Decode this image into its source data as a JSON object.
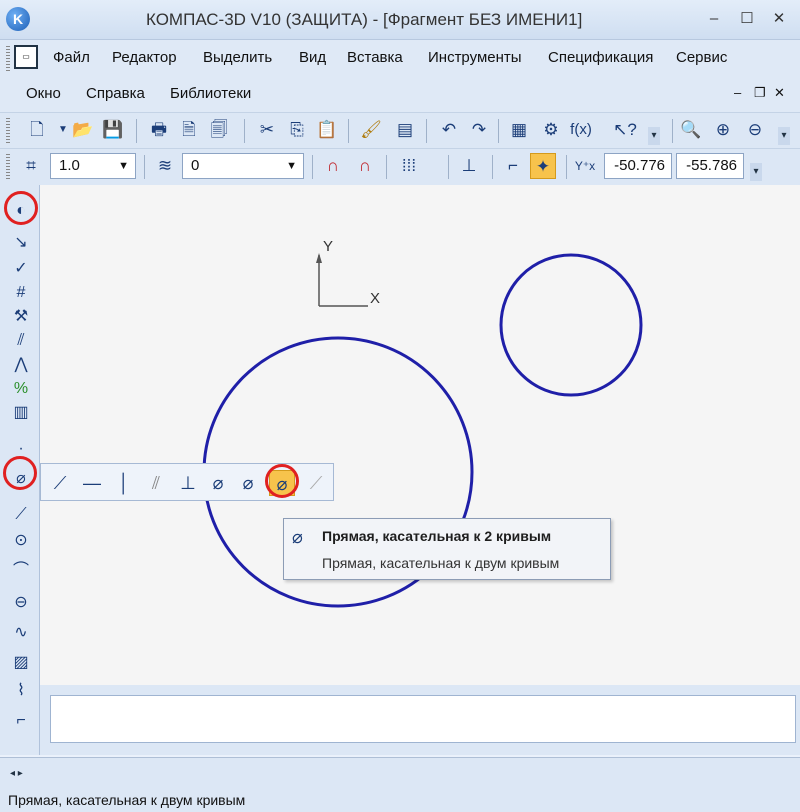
{
  "window": {
    "title": "КОМПАС-3D V10 (ЗАЩИТА) - [Фрагмент БЕЗ ИМЕНИ1]",
    "app_icon": "K",
    "controls": [
      "‒",
      "☐",
      "✕"
    ]
  },
  "menu": {
    "row1": [
      "Файл",
      "Редактор",
      "Выделить",
      "Вид",
      "Вставка",
      "Инструменты",
      "Спецификация",
      "Сервис"
    ],
    "row2": [
      "Окно",
      "Справка",
      "Библиотеки"
    ],
    "mdi_controls": [
      "‒",
      "❐",
      "✕"
    ],
    "doc_icon": "document-icon"
  },
  "toolbar2": {
    "step_value": "1.0",
    "layer_value": "0",
    "coord_x": "-50.776",
    "coord_y": "-55.786"
  },
  "drawing": {
    "axis_y_label": "Y",
    "axis_x_label": "X",
    "stroke_color": "#1f1fa8"
  },
  "tooltip": {
    "icon": "⌀",
    "title": "Прямая, касательная к 2 кривым",
    "description": "Прямая, касательная к двум кривым"
  },
  "status": {
    "text": "Прямая, касательная к двум кривым"
  }
}
